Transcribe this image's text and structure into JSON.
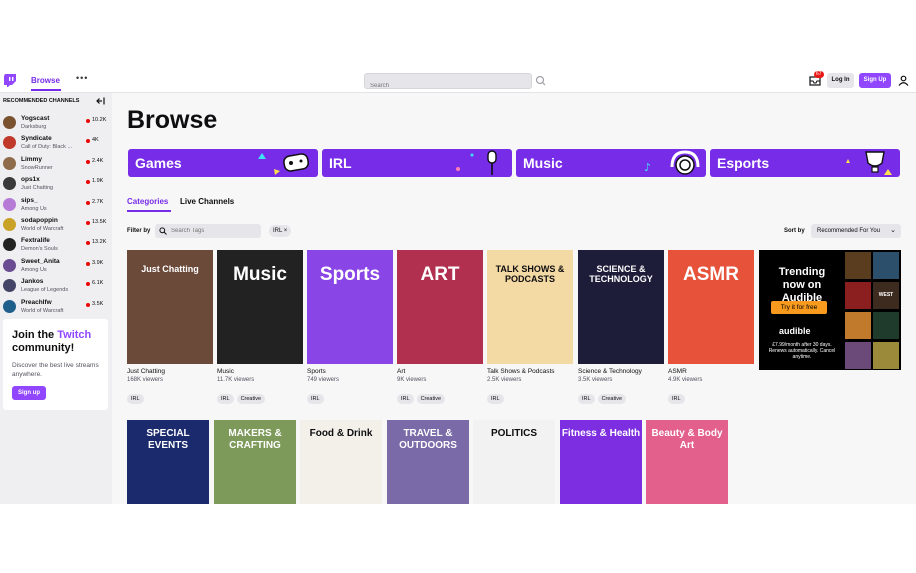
{
  "nav": {
    "browse_label": "Browse",
    "more_label": "•••",
    "search_placeholder": "Search",
    "notification_count": "67",
    "login_label": "Log In",
    "signup_label": "Sign Up"
  },
  "sidebar": {
    "heading": "RECOMMENDED CHANNELS",
    "channels": [
      {
        "name": "Yogscast",
        "game": "Darksburg",
        "viewers": "10.2K",
        "color": "#7a5230"
      },
      {
        "name": "Syndicate",
        "game": "Call of Duty: Black ...",
        "viewers": "4K",
        "color": "#c0392b"
      },
      {
        "name": "Limmy",
        "game": "SnowRunner",
        "viewers": "2.4K",
        "color": "#8e6b4a"
      },
      {
        "name": "ops1x",
        "game": "Just Chatting",
        "viewers": "1.9K",
        "color": "#3a3a3a"
      },
      {
        "name": "sips_",
        "game": "Among Us",
        "viewers": "2.7K",
        "color": "#b57bd6"
      },
      {
        "name": "sodapoppin",
        "game": "World of Warcraft",
        "viewers": "13.5K",
        "color": "#c9a227"
      },
      {
        "name": "Fextralife",
        "game": "Demon's Souls",
        "viewers": "13.2K",
        "color": "#222222"
      },
      {
        "name": "Sweet_Anita",
        "game": "Among Us",
        "viewers": "3.9K",
        "color": "#6a4c93"
      },
      {
        "name": "Jankos",
        "game": "League of Legends",
        "viewers": "6.1K",
        "color": "#444466"
      },
      {
        "name": "Preachlfw",
        "game": "World of Warcraft",
        "viewers": "3.5K",
        "color": "#1f5f8b"
      }
    ],
    "promo": {
      "title_prefix": "Join the",
      "title_brand": "Twitch",
      "title_suffix": "community!",
      "text": "Discover the best live streams anywhere.",
      "button": "Sign up"
    }
  },
  "main": {
    "title": "Browse",
    "banners": [
      "Games",
      "IRL",
      "Music",
      "Esports"
    ],
    "tabs": [
      "Categories",
      "Live Channels"
    ],
    "filter_label": "Filter by",
    "tag_placeholder": "Search Tags",
    "active_tag": "IRL ×",
    "sort_label": "Sort by",
    "sort_value": "Recommended For You",
    "categories": [
      {
        "title": "Just Chatting",
        "viewers": "168K viewers",
        "tags": [
          "IRL"
        ],
        "art": "Just Chatting",
        "bg": "#6b4a3a"
      },
      {
        "title": "Music",
        "viewers": "11.7K viewers",
        "tags": [
          "IRL",
          "Creative"
        ],
        "art": "Music",
        "bg": "#222222"
      },
      {
        "title": "Sports",
        "viewers": "749 viewers",
        "tags": [
          "IRL"
        ],
        "art": "Sports",
        "bg": "#8a45e6"
      },
      {
        "title": "Art",
        "viewers": "9K viewers",
        "tags": [
          "IRL",
          "Creative"
        ],
        "art": "ART",
        "bg": "#b2304f"
      },
      {
        "title": "Talk Shows & Podcasts",
        "viewers": "2.5K viewers",
        "tags": [
          "IRL"
        ],
        "art": "TALK SHOWS & PODCASTS",
        "bg": "#f3d9a4"
      },
      {
        "title": "Science & Technology",
        "viewers": "3.5K viewers",
        "tags": [
          "IRL",
          "Creative"
        ],
        "art": "SCIENCE & TECHNOLOGY",
        "bg": "#1d1d3a"
      },
      {
        "title": "ASMR",
        "viewers": "4.9K viewers",
        "tags": [
          "IRL"
        ],
        "art": "ASMR",
        "bg": "#e6523a"
      }
    ],
    "second_row": [
      {
        "art": "SPECIAL EVENTS",
        "bg": "#1a2a6c"
      },
      {
        "art": "MAKERS & CRAFTING",
        "bg": "#7d9a5a"
      },
      {
        "art": "Food & Drink",
        "bg": "#f3f0ea"
      },
      {
        "art": "TRAVEL & OUTDOORS",
        "bg": "#7a6aa8"
      },
      {
        "art": "POLITICS",
        "bg": "#f2f2f2"
      },
      {
        "art": "Fitness & Health",
        "bg": "#7d2ee0"
      },
      {
        "art": "Beauty & Body Art",
        "bg": "#e4608c"
      }
    ],
    "ad": {
      "headline": "Trending now on Audible",
      "cta": "Try it for free",
      "brand": "audible",
      "fine_print": "£7.99/month after 30 days. Renews automatically. Cancel anytime.",
      "books": [
        "",
        "",
        "",
        "WEST CORK",
        "",
        ""
      ]
    }
  },
  "colors": {
    "accent": "#9147ff",
    "accent_dark": "#772ce8",
    "live": "#eb0400"
  }
}
